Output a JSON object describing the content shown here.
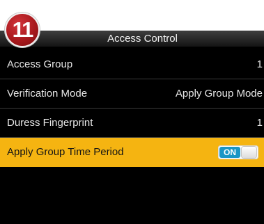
{
  "badge": {
    "number": "11"
  },
  "header": {
    "title": "Access Control"
  },
  "menu": {
    "items": [
      {
        "label": "Access Group",
        "value": "1"
      },
      {
        "label": "Verification Mode",
        "value": "Apply Group Mode"
      },
      {
        "label": "Duress Fingerprint",
        "value": "1"
      },
      {
        "label": "Apply Group Time Period",
        "toggle": "ON",
        "toggle_state": true
      }
    ]
  },
  "colors": {
    "highlight": "#f5b411",
    "toggle_on": "#1b96c6",
    "badge": "#a8191d",
    "screen_bg": "#000000"
  },
  "icons": {
    "badge": "step-number-badge"
  }
}
